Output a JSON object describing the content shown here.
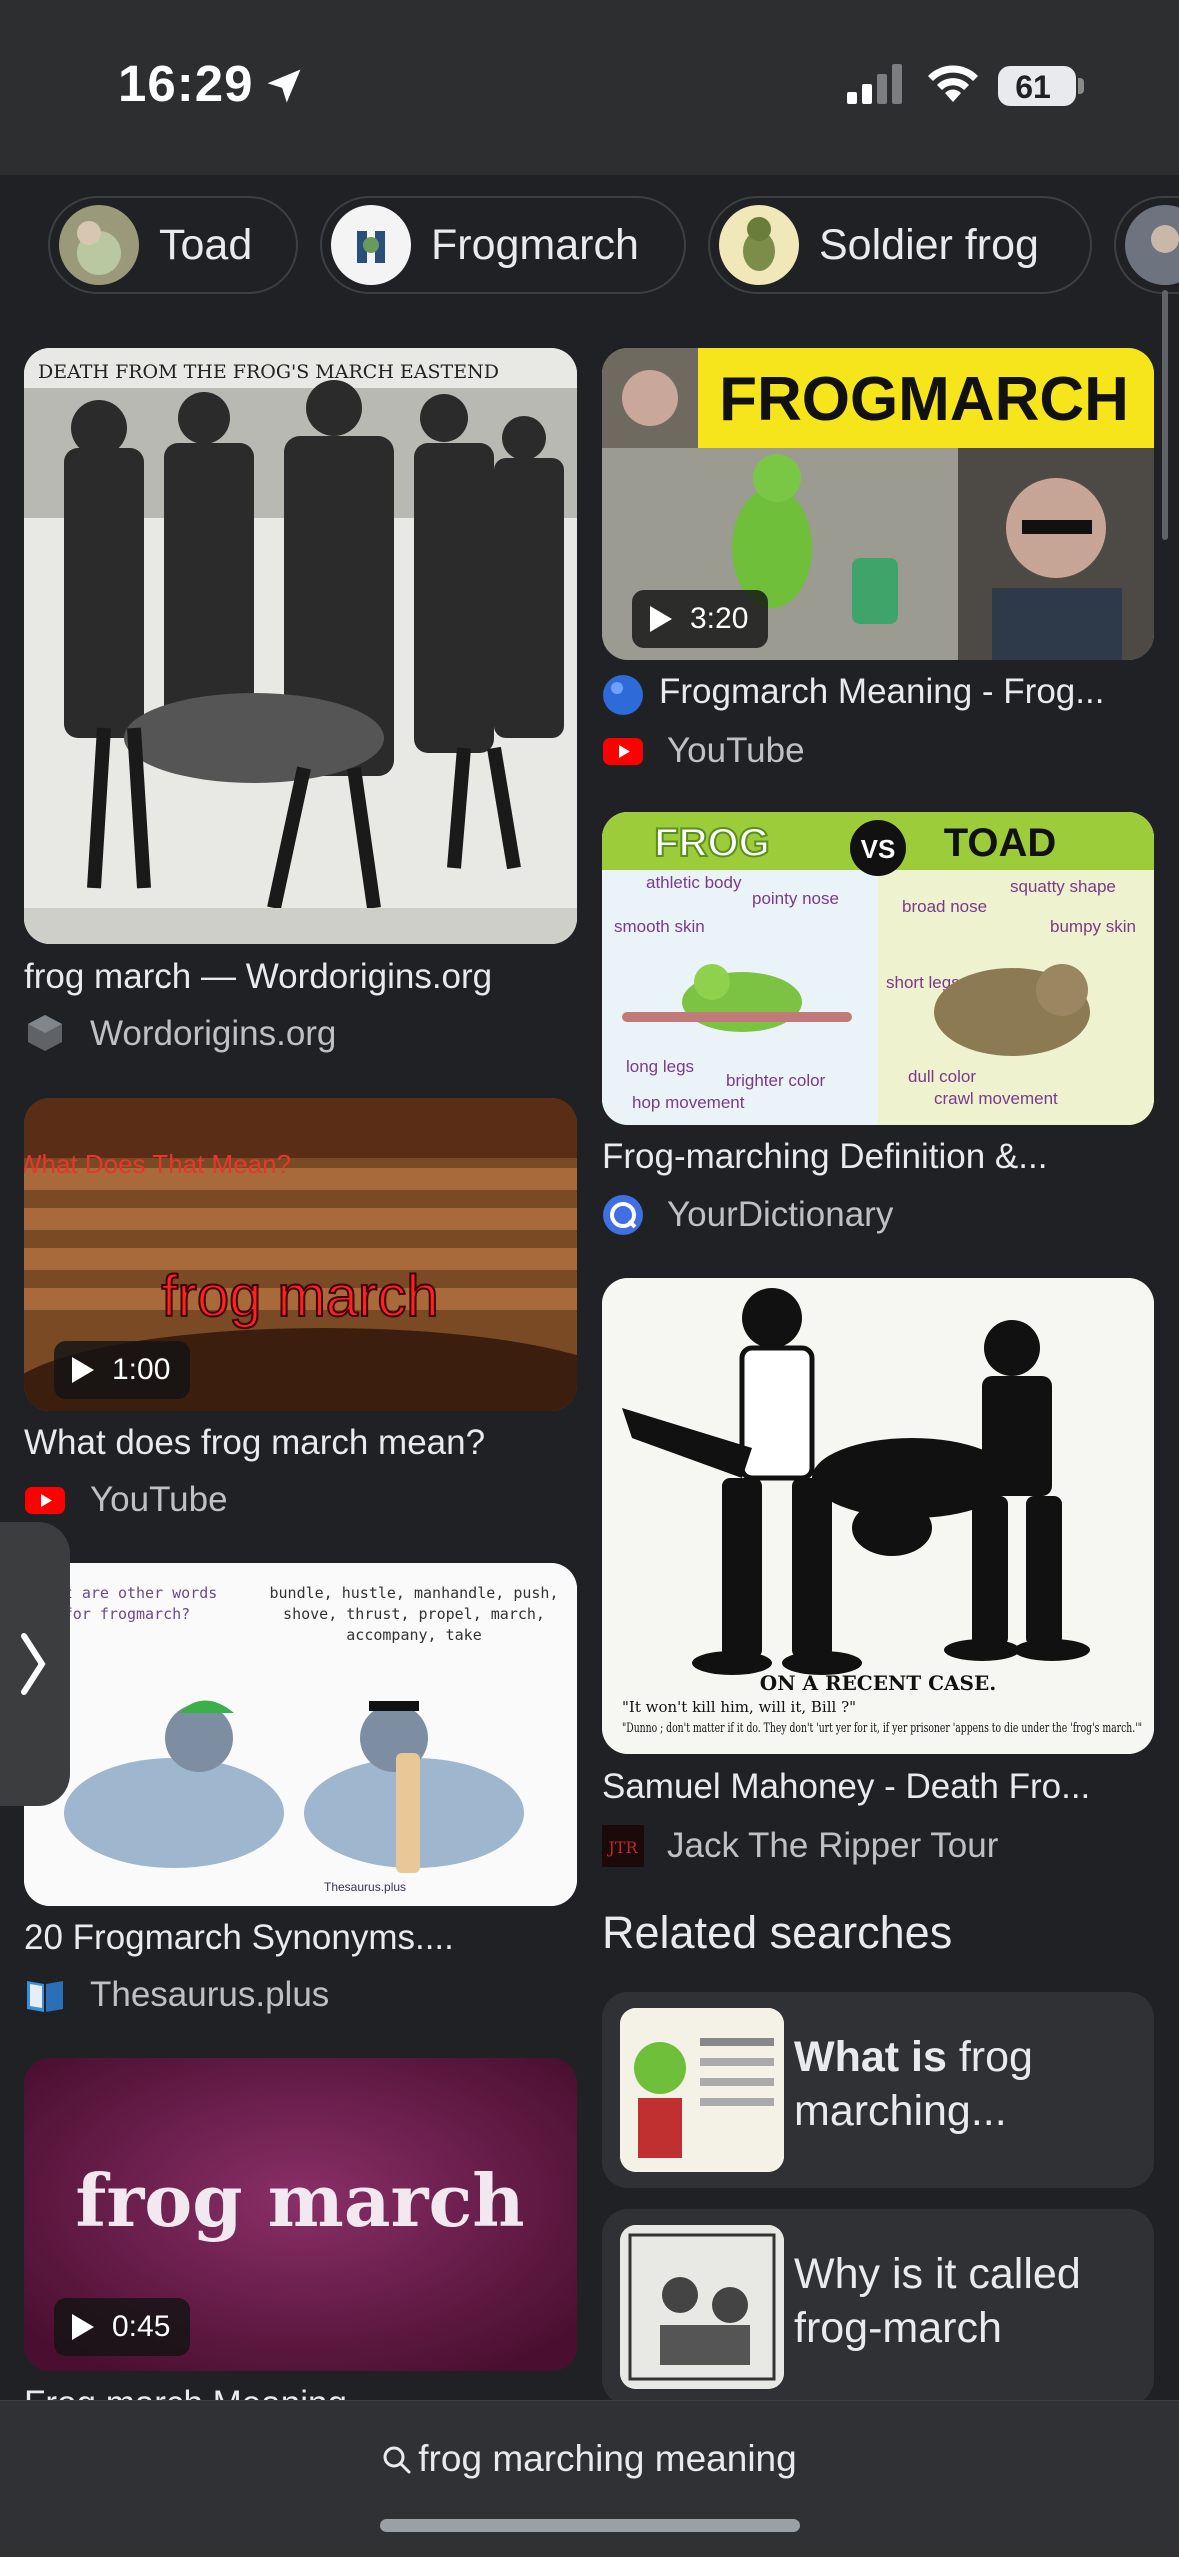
{
  "status": {
    "time": "16:29",
    "battery": "61"
  },
  "chips": [
    {
      "label": "Toad"
    },
    {
      "label": "Frogmarch"
    },
    {
      "label": "Soldier frog"
    }
  ],
  "results": [
    {
      "title": "frog march — Wordorigins.org",
      "source": "Wordorigins.org",
      "image_caption": "DEATH FROM THE FROG'S MARCH EASTEND"
    },
    {
      "title": "Frogmarch Meaning - Frog...",
      "source": "YouTube",
      "duration": "3:20",
      "image_caption": "FROGMARCH"
    },
    {
      "title": "Frog-marching Definition &...",
      "source": "YourDictionary",
      "image_text": {
        "left": "FROG",
        "vs": "VS",
        "right": "TOAD",
        "labels": [
          "athletic body",
          "pointy nose",
          "smooth skin",
          "long legs",
          "brighter color",
          "hop movement",
          "broad nose",
          "squatty shape",
          "bumpy skin",
          "short legs",
          "dull color",
          "crawl movement"
        ]
      }
    },
    {
      "title": "What does frog march mean?",
      "source": "YouTube",
      "duration": "1:00",
      "image_text": {
        "top": "What Does That Mean?",
        "main": "frog march"
      }
    },
    {
      "title": "Samuel Mahoney - Death Fro...",
      "source": "Jack The Ripper Tour",
      "image_caption": {
        "line1": "ON A RECENT CASE.",
        "line2": "\"It won't kill him, will it, Bill ?\"",
        "line3": "\"Dunno ; don't matter if it do. They don't 'urt yer for it, if yer prisoner 'appens to die under the 'frog's march.'\""
      }
    },
    {
      "title": "20 Frogmarch Synonyms....",
      "source": "Thesaurus.plus",
      "image_text": {
        "left": "what are other words for frogmarch?",
        "right": "bundle, hustle, manhandle, push, shove, thrust, propel, march, accompany, take",
        "credit": "Thesaurus.plus"
      }
    },
    {
      "title": "Frog march Meaning",
      "duration": "0:45",
      "image_text": "frog march"
    }
  ],
  "related": {
    "heading": "Related searches",
    "items": [
      {
        "bold": "What is",
        "rest": " frog marching..."
      },
      {
        "bold": "",
        "rest": "Why is it called frog-march"
      }
    ]
  },
  "bottom": {
    "query": "frog marching meaning"
  }
}
